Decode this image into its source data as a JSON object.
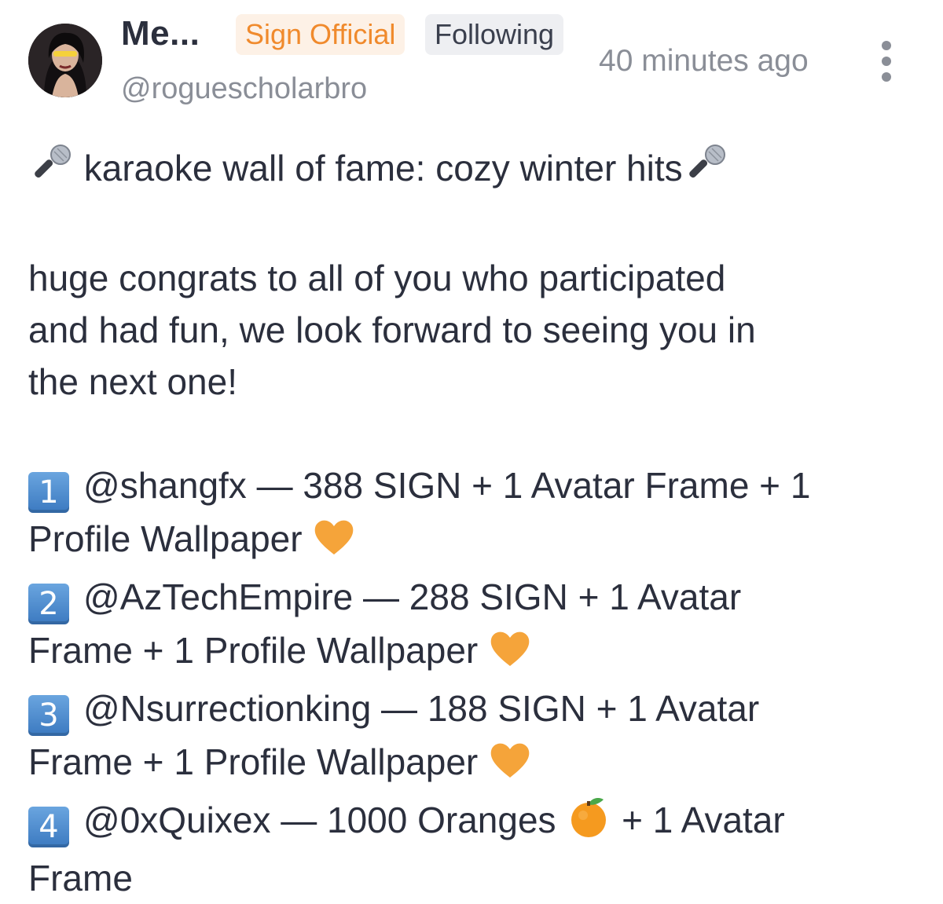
{
  "post": {
    "author": {
      "display_name": "Me...",
      "handle": "@roguescholarbro",
      "official_badge": "Sign Official",
      "follow_status": "Following"
    },
    "timestamp": "40 minutes ago",
    "title": "karaoke wall of fame: cozy winter hits",
    "body_lines": [
      "huge congrats to all of you who participated",
      "and had fun, we look forward to seeing you in",
      "the next one!"
    ],
    "winners": [
      {
        "rank": "1",
        "line1": "@shangfx — 388 SIGN + 1 Avatar Frame + 1",
        "line2": "Profile Wallpaper"
      },
      {
        "rank": "2",
        "line1": "@AzTechEmpire — 288 SIGN + 1 Avatar",
        "line2": "Frame + 1 Profile Wallpaper"
      },
      {
        "rank": "3",
        "line1": "@Nsurrectionking — 188 SIGN + 1 Avatar",
        "line2": "Frame + 1 Profile Wallpaper"
      },
      {
        "rank": "4",
        "line1a": "@0xQuixex — 1000 Oranges",
        "line1b": "+ 1 Avatar",
        "line2": "Frame"
      }
    ],
    "icons": {
      "title_prefix": "microphone-icon",
      "title_suffix": "microphone-icon",
      "heart": "orange-heart-icon",
      "orange": "tangerine-icon",
      "menu": "more-vertical-icon"
    },
    "colors": {
      "accent": "#f08a2c",
      "badge_bg": "#fdf1e6",
      "muted": "#8a8e97",
      "text": "#2b2f3d"
    }
  }
}
